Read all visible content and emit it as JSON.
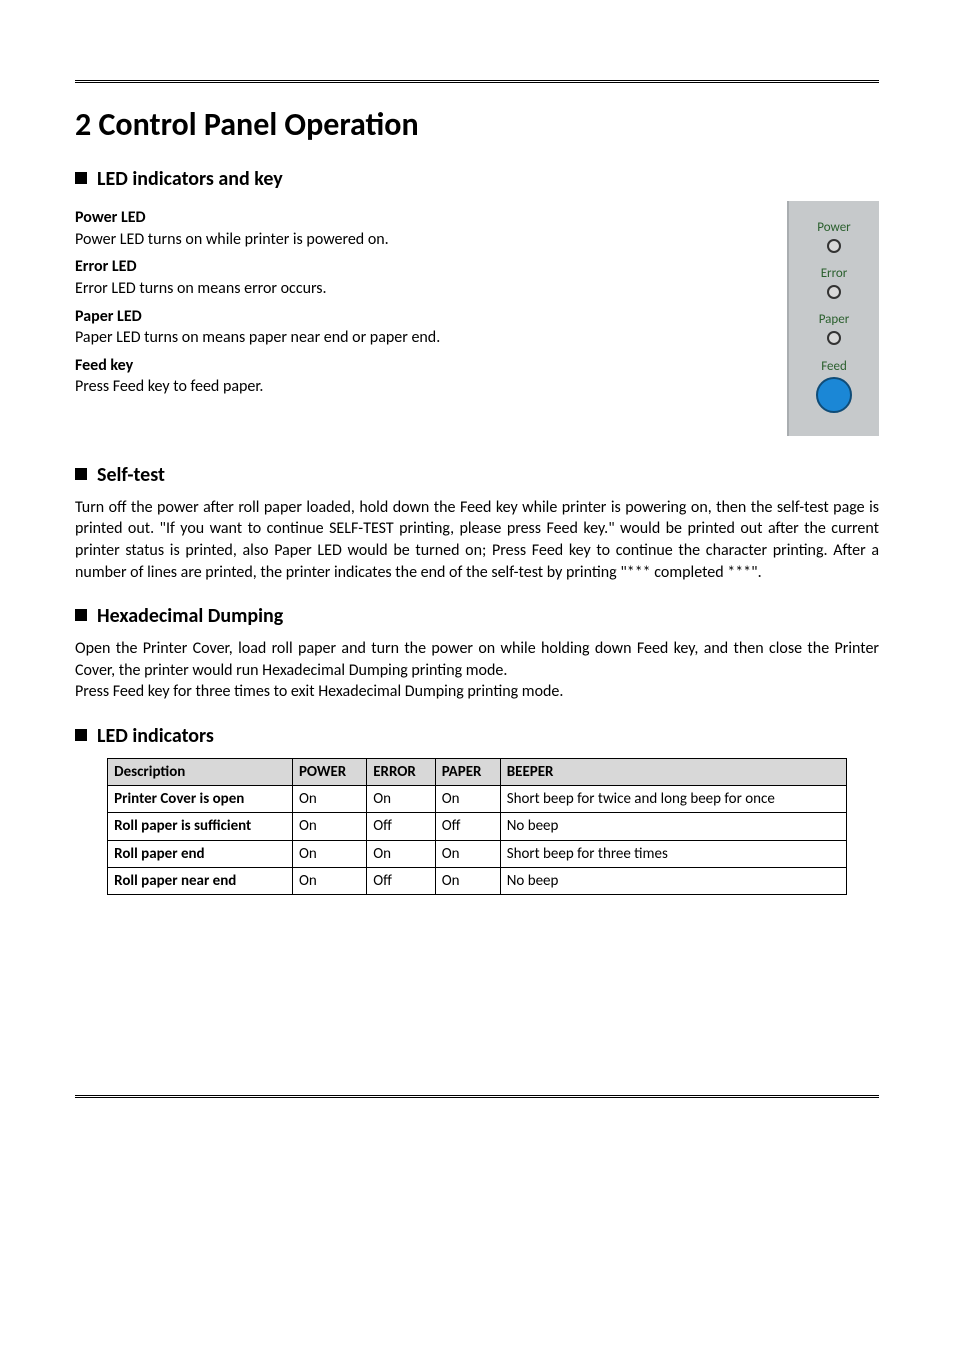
{
  "headings": {
    "main": "2 Control Panel Operation",
    "s1": "LED indicators and key",
    "s2": "Self-test",
    "s3": "Hexadecimal Dumping",
    "s4": "LED indicators"
  },
  "led_section": {
    "power_h": "Power LED",
    "power_d": "Power LED turns on while printer is powered on.",
    "error_h": "Error LED",
    "error_d": "Error LED turns on means error occurs.",
    "paper_h": "Paper LED",
    "paper_d": "Paper LED turns on means paper near end or paper end.",
    "feed_h": "Feed key",
    "feed_d": "Press Feed key to feed paper."
  },
  "panel": {
    "power": "Power",
    "error": "Error",
    "paper": "Paper",
    "feed": "Feed"
  },
  "selftest_para": "Turn off the power after roll paper loaded, hold down the Feed key while printer is powering on, then the self-test page is printed out. \"If you want to continue SELF-TEST printing, please press Feed key.\" would be printed out after the current printer status is printed, also Paper LED would be turned on; Press Feed key to continue the character printing. After a number of lines are printed, the printer indicates the end of the self-test by printing \"*** completed ***\".",
  "hex_para1": "Open the Printer Cover, load roll paper and turn the power on while holding down Feed key, and then close the Printer Cover, the printer would run Hexadecimal Dumping printing mode.",
  "hex_para2": "Press Feed key for three times to exit Hexadecimal Dumping printing mode.",
  "table": {
    "headers": {
      "c0": "Description",
      "c1": "POWER",
      "c2": "ERROR",
      "c3": "PAPER",
      "c4": "BEEPER"
    },
    "rows": [
      {
        "c0": "Printer Cover is open",
        "c1": "On",
        "c2": "On",
        "c3": "On",
        "c4": "Short beep for twice and long beep for once"
      },
      {
        "c0": "Roll paper is sufficient",
        "c1": "On",
        "c2": "Off",
        "c3": "Off",
        "c4": "No beep"
      },
      {
        "c0": "Roll paper end",
        "c1": "On",
        "c2": "On",
        "c3": "On",
        "c4": "Short beep for three times"
      },
      {
        "c0": "Roll paper near end",
        "c1": "On",
        "c2": "Off",
        "c3": "On",
        "c4": "No beep"
      }
    ]
  }
}
